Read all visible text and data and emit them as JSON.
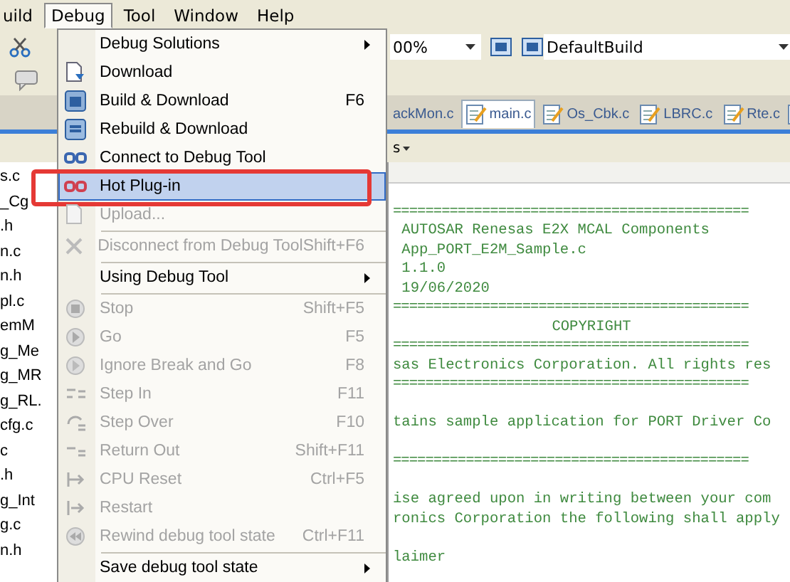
{
  "menubar": [
    {
      "label": "uild",
      "open": false
    },
    {
      "label": "Debug",
      "open": true
    },
    {
      "label": "Tool",
      "open": false
    },
    {
      "label": "Window",
      "open": false
    },
    {
      "label": "Help",
      "open": false
    }
  ],
  "toolbar": {
    "zoom_combo": "00%",
    "build_combo": "DefaultBuild"
  },
  "tabs": [
    {
      "label": "ackMon.c",
      "selected": false
    },
    {
      "label": "main.c",
      "selected": true
    },
    {
      "label": "Os_Cbk.c",
      "selected": false
    },
    {
      "label": "LBRC.c",
      "selected": false
    },
    {
      "label": "Rte.c",
      "selected": false
    }
  ],
  "panel_menu": "s",
  "file_tree": {
    "items": [
      "s.c",
      "_Cg",
      ".h",
      "n.c",
      "n.h",
      "pl.c",
      "emM",
      "g_Me",
      "g_MR",
      "g_RL.",
      "cfg.c",
      "c",
      ".h",
      "g_Int",
      "g.c",
      "n.h"
    ]
  },
  "editor": {
    "lines": [
      {
        "kind": "blank"
      },
      {
        "kind": "rule",
        "text": "============================================"
      },
      {
        "kind": "text",
        "text": " AUTOSAR Renesas E2X MCAL Components"
      },
      {
        "kind": "text",
        "text": " App_PORT_E2M_Sample.c"
      },
      {
        "kind": "text",
        "text": " 1.1.0"
      },
      {
        "kind": "text",
        "text": " 19/06/2020"
      },
      {
        "kind": "rule",
        "text": "============================================"
      },
      {
        "kind": "heading",
        "text": "COPYRIGHT"
      },
      {
        "kind": "rule",
        "text": "============================================"
      },
      {
        "kind": "text",
        "text": "sas Electronics Corporation. All rights res"
      },
      {
        "kind": "rule",
        "text": "============================================"
      },
      {
        "kind": "blank"
      },
      {
        "kind": "text",
        "text": "tains sample application for PORT Driver Co"
      },
      {
        "kind": "blank"
      },
      {
        "kind": "rule",
        "text": "============================================"
      },
      {
        "kind": "blank"
      },
      {
        "kind": "text",
        "text": "ise agreed upon in writing between your com"
      },
      {
        "kind": "text",
        "text": "ronics Corporation the following shall apply"
      },
      {
        "kind": "blank"
      },
      {
        "kind": "text",
        "text": "laimer"
      }
    ]
  },
  "menu": {
    "items": [
      {
        "kind": "item",
        "label": "Debug Solutions",
        "submenu": true,
        "disabled": false,
        "selected": false,
        "annotated": false
      },
      {
        "kind": "item",
        "label": "Download",
        "disabled": false,
        "selected": false,
        "annotated": false
      },
      {
        "kind": "item",
        "label": "Build & Download",
        "shortcut": "F6",
        "disabled": false,
        "selected": false,
        "annotated": false
      },
      {
        "kind": "item",
        "label": "Rebuild & Download",
        "disabled": false,
        "selected": false,
        "annotated": false
      },
      {
        "kind": "item",
        "label": "Connect to Debug Tool",
        "disabled": false,
        "selected": false,
        "annotated": false
      },
      {
        "kind": "item",
        "label": "Hot Plug-in",
        "disabled": false,
        "selected": true,
        "annotated": true
      },
      {
        "kind": "item",
        "label": "Upload...",
        "disabled": true,
        "selected": false,
        "annotated": false
      },
      {
        "kind": "separator"
      },
      {
        "kind": "item",
        "label": "Disconnect from Debug Tool",
        "shortcut": "Shift+F6",
        "disabled": true,
        "selected": false,
        "annotated": false
      },
      {
        "kind": "separator"
      },
      {
        "kind": "item",
        "label": "Using Debug Tool",
        "submenu": true,
        "disabled": false,
        "selected": false,
        "annotated": false
      },
      {
        "kind": "separator"
      },
      {
        "kind": "item",
        "label": "Stop",
        "shortcut": "Shift+F5",
        "disabled": true,
        "selected": false,
        "annotated": false
      },
      {
        "kind": "item",
        "label": "Go",
        "shortcut": "F5",
        "disabled": true,
        "selected": false,
        "annotated": false
      },
      {
        "kind": "item",
        "label": "Ignore Break and Go",
        "shortcut": "F8",
        "disabled": true,
        "selected": false,
        "annotated": false
      },
      {
        "kind": "item",
        "label": "Step In",
        "shortcut": "F11",
        "disabled": true,
        "selected": false,
        "annotated": false
      },
      {
        "kind": "item",
        "label": "Step Over",
        "shortcut": "F10",
        "disabled": true,
        "selected": false,
        "annotated": false
      },
      {
        "kind": "item",
        "label": "Return Out",
        "shortcut": "Shift+F11",
        "disabled": true,
        "selected": false,
        "annotated": false
      },
      {
        "kind": "item",
        "label": "CPU Reset",
        "shortcut": "Ctrl+F5",
        "disabled": true,
        "selected": false,
        "annotated": false
      },
      {
        "kind": "item",
        "label": "Restart",
        "disabled": true,
        "selected": false,
        "annotated": false
      },
      {
        "kind": "item",
        "label": "Rewind debug tool state",
        "shortcut": "Ctrl+F11",
        "disabled": true,
        "selected": false,
        "annotated": false
      },
      {
        "kind": "separator"
      },
      {
        "kind": "item",
        "label": "Save debug tool state",
        "submenu": true,
        "disabled": false,
        "selected": false,
        "annotated": false
      }
    ]
  }
}
